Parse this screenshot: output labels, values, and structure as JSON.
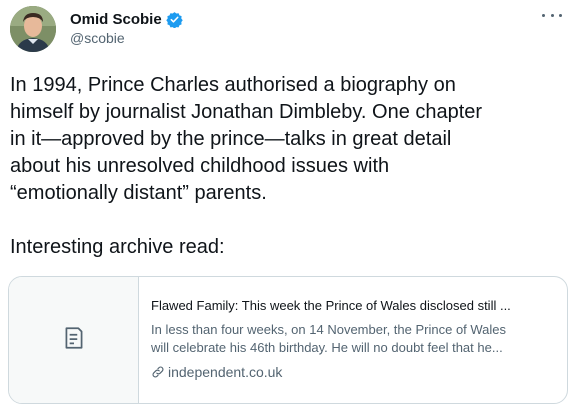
{
  "author": {
    "display_name": "Omid Scobie",
    "handle": "@scobie",
    "avatar_icon": "avatar-photo",
    "verified_icon": "verified-badge-icon",
    "verified_color": "#1d9bf0"
  },
  "menu": {
    "icon": "more-options-icon"
  },
  "tweet": {
    "paragraph_1": "In 1994, Prince Charles authorised a biography on\nhimself by journalist Jonathan Dimbleby. One chapter\nin it—approved by the prince—talks in great detail\nabout his unresolved childhood issues with\n“emotionally distant” parents.",
    "paragraph_2": "Interesting archive read:"
  },
  "link_card": {
    "thumbnail_icon": "document-icon",
    "title": "Flawed Family: This week the Prince of Wales disclosed still ...",
    "description_line_1": "In less than four weeks, on 14 November, the Prince of Wales",
    "description_line_2": "will celebrate his 46th birthday. He will no doubt feel that he...",
    "domain": "independent.co.uk",
    "domain_icon": "link-icon"
  }
}
